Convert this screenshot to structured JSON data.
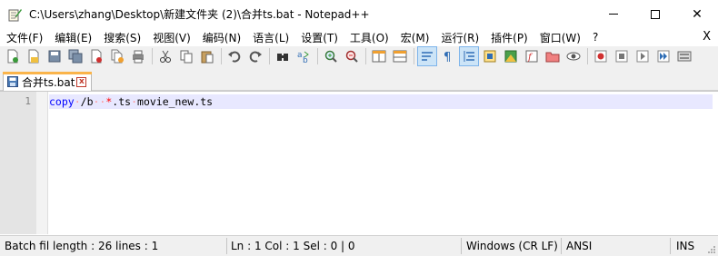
{
  "window": {
    "title": "C:\\Users\\zhang\\Desktop\\新建文件夹 (2)\\合并ts.bat - Notepad++",
    "minimize_label": "",
    "maximize_label": "",
    "close_label": "✕"
  },
  "menu": {
    "items": [
      "文件(F)",
      "编辑(E)",
      "搜索(S)",
      "视图(V)",
      "编码(N)",
      "语言(L)",
      "设置(T)",
      "工具(O)",
      "宏(M)",
      "运行(R)",
      "插件(P)",
      "窗口(W)",
      "?"
    ],
    "close_label": "X"
  },
  "toolbar": {
    "icons": [
      "new-file-icon",
      "open-file-icon",
      "save-icon",
      "save-all-icon",
      "close-icon",
      "close-all-icon",
      "print-icon",
      "cut-icon",
      "copy-icon",
      "paste-icon",
      "undo-icon",
      "redo-icon",
      "find-icon",
      "replace-icon",
      "zoom-in-icon",
      "zoom-out-icon",
      "sync-vertical-icon",
      "sync-horizontal-icon",
      "word-wrap-icon",
      "show-all-chars-icon",
      "indent-guide-icon",
      "udl-icon",
      "doc-map-icon",
      "function-list-icon",
      "folder-workspace-icon",
      "monitoring-icon",
      "record-macro-icon",
      "stop-record-icon",
      "play-macro-icon",
      "run-macro-multiple-icon",
      "save-macro-icon"
    ],
    "colors": {
      "accent_blue": "#2f6db5",
      "accent_red": "#d03030",
      "accent_green": "#3a9a3a",
      "accent_orange": "#f0a030"
    }
  },
  "tab": {
    "label": "合并ts.bat",
    "close_label": "x"
  },
  "editor": {
    "line_number": "1",
    "code_tokens": {
      "keyword": "copy",
      "space1": "·",
      "arg": "/b",
      "space2": "··",
      "star": "*",
      "ext": ".ts",
      "space3": "·",
      "outfile": "movie_new.ts"
    }
  },
  "status": {
    "file_info": "Batch fil length : 26    lines : 1",
    "position": "Ln : 1    Col : 1    Sel : 0 | 0",
    "eol": "Windows (CR LF)",
    "encoding": "ANSI",
    "mode": "INS"
  }
}
